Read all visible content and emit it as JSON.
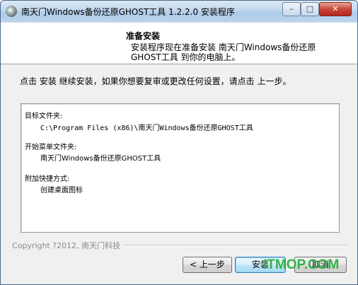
{
  "window": {
    "title": "南天门Windows备份还原GHOST工具 1.2.2.0 安装程序",
    "controls": {
      "minimize": "–",
      "maximize": "□",
      "close": "✕"
    }
  },
  "header": {
    "title": "准备安装",
    "description": "安装程序现在准备安装 南天门Windows备份还原GHOST工具 到你的电脑上。"
  },
  "instruction": "点击 安装 继续安装，如果你想要复审或更改任何设置，请点击 上一步。",
  "summary": {
    "dest_label": "目标文件夹:",
    "dest_value": "C:\\Program Files (x86)\\南天门Windows备份还原GHOST工具",
    "menu_label": "开始菜单文件夹:",
    "menu_value": "南天门Windows备份还原GHOST工具",
    "tasks_label": "附加快捷方式:",
    "tasks_value": "创建桌面图标"
  },
  "footer": {
    "copyright": "Copyright ?2012, 南天门科技"
  },
  "buttons": {
    "back": "< 上一步",
    "install": "安装",
    "cancel": "取消"
  },
  "watermark": "ITMOP.COM"
}
